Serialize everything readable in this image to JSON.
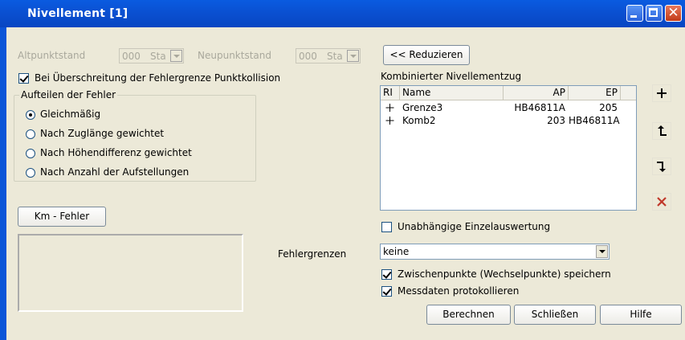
{
  "window": {
    "title": "Nivellement [1]",
    "controls": {
      "minimize": "minimize",
      "maximize": "maximize",
      "close": "✕"
    }
  },
  "altpunktstand": {
    "label": "Altpunktstand",
    "value": "000",
    "suffix": "Sta"
  },
  "neupunktstand": {
    "label": "Neupunktstand",
    "value": "000",
    "suffix": "Sta"
  },
  "collision_checkbox": {
    "label": "Bei Überschreitung der Fehlergrenze Punktkollision",
    "checked": true
  },
  "distribute_group": {
    "legend": "Aufteilen der Fehler",
    "options": [
      {
        "label": "Gleichmäßig",
        "checked": true
      },
      {
        "label": "Nach Zuglänge gewichtet",
        "checked": false
      },
      {
        "label": "Nach Höhendifferenz gewichtet",
        "checked": false
      },
      {
        "label": "Nach Anzahl der Aufstellungen",
        "checked": false
      }
    ]
  },
  "km_button": "Km - Fehler",
  "reduce_button": "<< Reduzieren",
  "combined": {
    "label": "Kombinierter Nivellementzug",
    "columns": [
      "RI",
      "Name",
      "AP",
      "EP"
    ],
    "rows": [
      {
        "marker": "+",
        "name": "Grenze3",
        "ap": "HB46811A",
        "ep": "205"
      },
      {
        "marker": "+",
        "name": "Komb2",
        "ap": "203",
        "ep": "HB46811A"
      }
    ]
  },
  "side_icons": [
    "add-icon",
    "move-up-icon",
    "move-down-icon",
    "delete-icon"
  ],
  "independent_checkbox": {
    "label": "Unabhängige Einzelauswertung",
    "checked": false
  },
  "fehlergrenzen": {
    "label": "Fehlergrenzen",
    "value": "keine"
  },
  "save_checkbox": {
    "label": "Zwischenpunkte (Wechselpunkte) speichern",
    "checked": true
  },
  "log_checkbox": {
    "label": "Messdaten protokollieren",
    "checked": true
  },
  "buttons": {
    "calc": "Berechnen",
    "close": "Schließen",
    "help": "Hilfe"
  },
  "colors": {
    "titlebar": "#0a4fd0",
    "client": "#ece9d8",
    "delete_icon": "#c0392b"
  }
}
